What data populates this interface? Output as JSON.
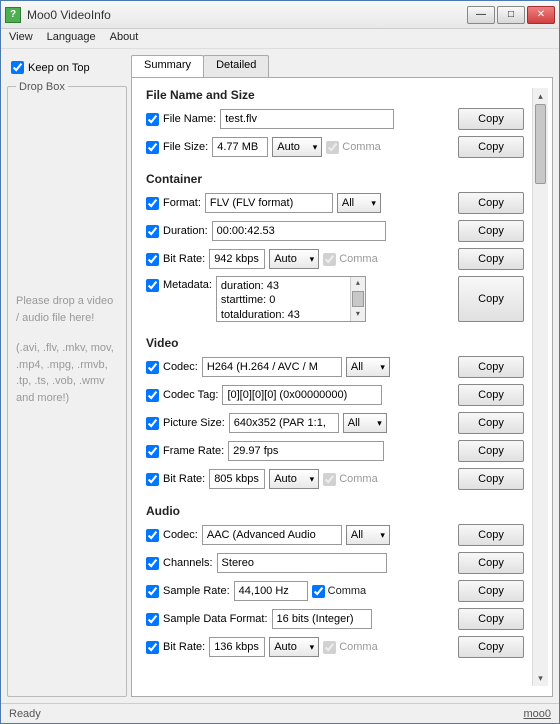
{
  "title": "Moo0 VideoInfo",
  "menu": {
    "view": "View",
    "language": "Language",
    "about": "About"
  },
  "keep_on_top": "Keep on Top",
  "dropbox": {
    "title": "Drop Box",
    "text": "Please drop a video / audio file here!",
    "hint": "(.avi, .flv, .mkv, mov, .mp4, .mpg, .rmvb, .tp, .ts, .vob, .wmv and more!)"
  },
  "tabs": {
    "summary": "Summary",
    "detailed": "Detailed"
  },
  "copy_label": "Copy",
  "auto_label": "Auto",
  "all_label": "All",
  "comma_label": "Comma",
  "sections": {
    "file": {
      "heading": "File Name and Size",
      "filename_lbl": "File Name:",
      "filename_val": "test.flv",
      "filesize_lbl": "File Size:",
      "filesize_val": "4.77 MB"
    },
    "container": {
      "heading": "Container",
      "format_lbl": "Format:",
      "format_val": "FLV  (FLV format)",
      "duration_lbl": "Duration:",
      "duration_val": "00:00:42.53",
      "bitrate_lbl": "Bit Rate:",
      "bitrate_val": "942 kbps",
      "metadata_lbl": "Metadata:",
      "metadata_val": "duration: 43\nstarttime: 0\ntotalduration: 43"
    },
    "video": {
      "heading": "Video",
      "codec_lbl": "Codec:",
      "codec_val": "H264  (H.264 / AVC / M",
      "codectag_lbl": "Codec Tag:",
      "codectag_val": "[0][0][0][0] (0x00000000)",
      "picsize_lbl": "Picture Size:",
      "picsize_val": "640x352  (PAR 1:1,",
      "framerate_lbl": "Frame Rate:",
      "framerate_val": "29.97 fps",
      "bitrate_lbl": "Bit Rate:",
      "bitrate_val": "805 kbps"
    },
    "audio": {
      "heading": "Audio",
      "codec_lbl": "Codec:",
      "codec_val": "AAC  (Advanced Audio",
      "channels_lbl": "Channels:",
      "channels_val": "Stereo",
      "samplerate_lbl": "Sample Rate:",
      "samplerate_val": "44,100 Hz",
      "sampledfmt_lbl": "Sample Data Format:",
      "sampledfmt_val": "16 bits (Integer)",
      "bitrate_lbl": "Bit Rate:",
      "bitrate_val": "136 kbps"
    }
  },
  "status": {
    "ready": "Ready",
    "link": "moo0"
  }
}
